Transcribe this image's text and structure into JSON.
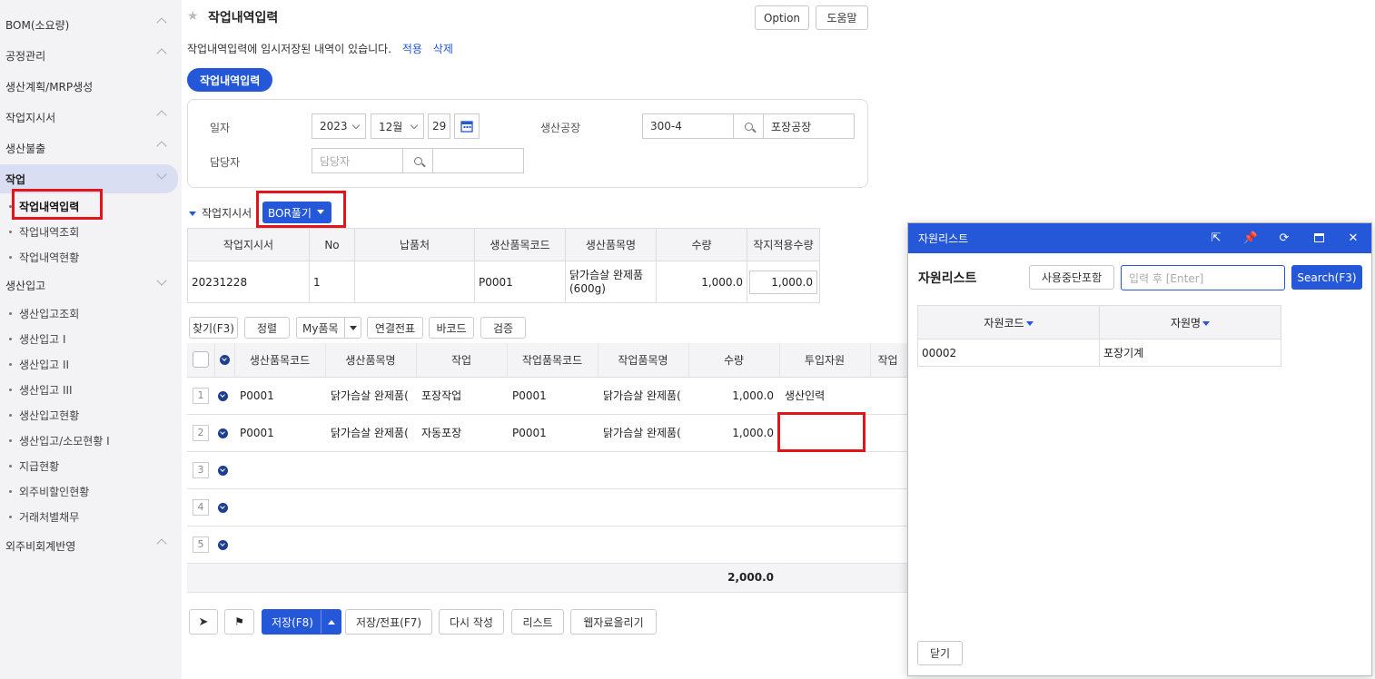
{
  "sidebar": {
    "items": [
      {
        "label": "BOM(소요량)"
      },
      {
        "label": "공정관리"
      },
      {
        "label": "생산계획/MRP생성"
      },
      {
        "label": "작업지시서"
      },
      {
        "label": "생산불출"
      },
      {
        "label": "작업"
      },
      {
        "label": "생산입고"
      },
      {
        "label": "외주비회계반영"
      }
    ],
    "work_sub": [
      "작업내역입력",
      "작업내역조회",
      "작업내역현황"
    ],
    "receipt_sub": [
      "생산입고조회",
      "생산입고 I",
      "생산입고 II",
      "생산입고 III",
      "생산입고현황",
      "생산입고/소모현황 I",
      "지급현황",
      "외주비할인현황",
      "거래처별채무"
    ]
  },
  "header": {
    "title": "작업내역입력",
    "option_label": "Option",
    "help_label": "도움말"
  },
  "temp_notice": {
    "text": "작업내역입력에 임시저장된 내역이 있습니다.",
    "apply": "적용",
    "delete": "삭제"
  },
  "tab_pill": "작업내역입력",
  "form": {
    "date_label": "일자",
    "year": "2023",
    "month": "12월",
    "day": "29",
    "factory_label": "생산공장",
    "factory_code": "300-4",
    "factory_name": "포장공장",
    "manager_label": "담당자",
    "manager_placeholder": "담당자"
  },
  "work_order_section": {
    "label": "작업지시서",
    "bor_button": "BOR풀기",
    "headers": [
      "작업지시서",
      "No",
      "납품처",
      "생산품목코드",
      "생산품목명",
      "수량",
      "작지적용수량"
    ],
    "row": {
      "order": "20231228",
      "no": "1",
      "customer": "",
      "code": "P0001",
      "name": "닭가슴살 완제품(600g)",
      "qty": "1,000.0",
      "applied": "1,000.0"
    }
  },
  "toolbar": {
    "find": "찾기(F3)",
    "sort": "정렬",
    "myitems": "My품목",
    "link_slip": "연결전표",
    "barcode": "바코드",
    "verify": "검증"
  },
  "grid": {
    "headers": [
      "생산품목코드",
      "생산품목명",
      "작업",
      "작업품목코드",
      "작업품목명",
      "수량",
      "투입자원",
      "작업"
    ],
    "rows": [
      {
        "num": "1",
        "code": "P0001",
        "name": "닭가슴살 완제품(",
        "work": "포장작업",
        "wcode": "P0001",
        "wname": "닭가슴살 완제품(",
        "qty": "1,000.0",
        "resource": "생산인력"
      },
      {
        "num": "2",
        "code": "P0001",
        "name": "닭가슴살 완제품(",
        "work": "자동포장",
        "wcode": "P0001",
        "wname": "닭가슴살 완제품(",
        "qty": "1,000.0",
        "resource": ""
      },
      {
        "num": "3",
        "code": "",
        "name": "",
        "work": "",
        "wcode": "",
        "wname": "",
        "qty": "",
        "resource": ""
      },
      {
        "num": "4",
        "code": "",
        "name": "",
        "work": "",
        "wcode": "",
        "wname": "",
        "qty": "",
        "resource": ""
      },
      {
        "num": "5",
        "code": "",
        "name": "",
        "work": "",
        "wcode": "",
        "wname": "",
        "qty": "",
        "resource": ""
      }
    ],
    "total": "2,000.0"
  },
  "bottom": {
    "save": "저장(F8)",
    "save_slip": "저장/전표(F7)",
    "rewrite": "다시 작성",
    "list": "리스트",
    "upload": "웹자료올리기"
  },
  "popup": {
    "header_title": "자원리스트",
    "title": "자원리스트",
    "include_inactive": "사용중단포함",
    "search_placeholder": "입력 후 [Enter]",
    "search_button": "Search(F3)",
    "col_code": "자원코드",
    "col_name": "자원명",
    "rows": [
      {
        "code": "00002",
        "name": "포장기계"
      }
    ],
    "close": "닫기"
  },
  "colors": {
    "accent": "#2458d8",
    "highlight": "#e3151b"
  }
}
